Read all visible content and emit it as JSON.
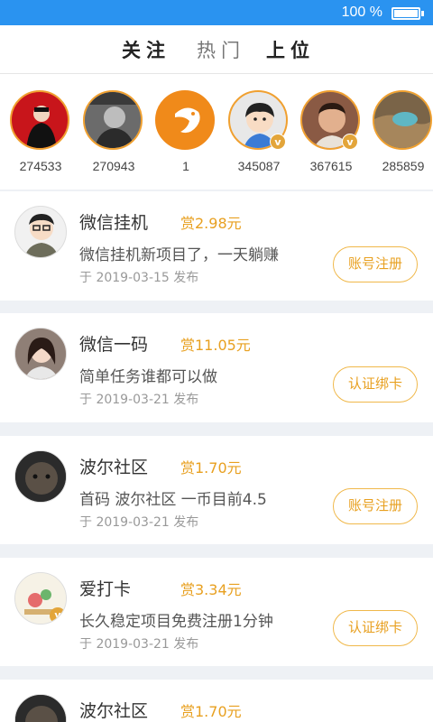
{
  "status_bar": {
    "battery_text": "100 %",
    "battery_level": 1.0
  },
  "tabs": [
    {
      "label": "关注",
      "active": true
    },
    {
      "label": "热门",
      "active": false
    },
    {
      "label": "上位",
      "active": true
    }
  ],
  "followed_users": [
    {
      "count": "274533",
      "verified": false,
      "avatar": "man-dark-jacket"
    },
    {
      "count": "270943",
      "verified": false,
      "avatar": "man-bw-photo"
    },
    {
      "count": "1",
      "verified": false,
      "avatar": "orange-fish-logo"
    },
    {
      "count": "345087",
      "verified": true,
      "avatar": "cartoon-boy"
    },
    {
      "count": "367615",
      "verified": true,
      "avatar": "young-man"
    },
    {
      "count": "285859",
      "verified": false,
      "avatar": "landscape"
    }
  ],
  "tasks": [
    {
      "title": "微信挂机",
      "reward": "赏2.98元",
      "desc": "微信挂机新项目了，一天躺赚",
      "date": "于 2019-03-15 发布",
      "button": "账号注册",
      "avatar": "cartoon-man-glasses",
      "verified": false
    },
    {
      "title": "微信一码",
      "reward": "赏11.05元",
      "desc": "简单任务谁都可以做",
      "date": "于 2019-03-21 发布",
      "button": "认证绑卡",
      "avatar": "woman-selfie",
      "verified": false
    },
    {
      "title": "波尔社区",
      "reward": "赏1.70元",
      "desc": "首码 波尔社区 一币目前4.5",
      "date": "于 2019-03-21 发布",
      "button": "账号注册",
      "avatar": "child-photo",
      "verified": false
    },
    {
      "title": "爱打卡",
      "reward": "赏3.34元",
      "desc": "长久稳定项目免费注册1分钟",
      "date": "于 2019-03-21 发布",
      "button": "认证绑卡",
      "avatar": "illustration",
      "verified": true
    },
    {
      "title": "波尔社区",
      "reward": "赏1.70元",
      "desc": "",
      "date": "",
      "button": "",
      "avatar": "child-photo",
      "verified": false
    }
  ],
  "colors": {
    "status_bar": "#2a93f0",
    "accent": "#e8a020",
    "badge": "#e3a53a",
    "background": "#eef1f5"
  }
}
